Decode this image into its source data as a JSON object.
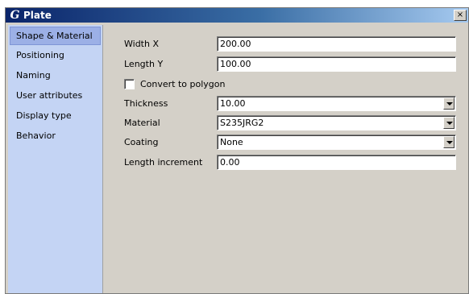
{
  "window": {
    "title": "Plate",
    "close_symbol": "×"
  },
  "sidebar": {
    "items": [
      {
        "label": "Shape & Material",
        "active": true
      },
      {
        "label": "Positioning"
      },
      {
        "label": "Naming"
      },
      {
        "label": "User attributes"
      },
      {
        "label": "Display type"
      },
      {
        "label": "Behavior"
      }
    ]
  },
  "form": {
    "width_x": {
      "label": "Width X",
      "value": "200.00"
    },
    "length_y": {
      "label": "Length Y",
      "value": "100.00"
    },
    "convert": {
      "label": "Convert to polygon",
      "checked": false
    },
    "thickness": {
      "label": "Thickness",
      "value": "10.00"
    },
    "material": {
      "label": "Material",
      "value": "S235JRG2"
    },
    "coating": {
      "label": "Coating",
      "value": "None"
    },
    "length_increment": {
      "label": "Length increment",
      "value": "0.00"
    }
  }
}
